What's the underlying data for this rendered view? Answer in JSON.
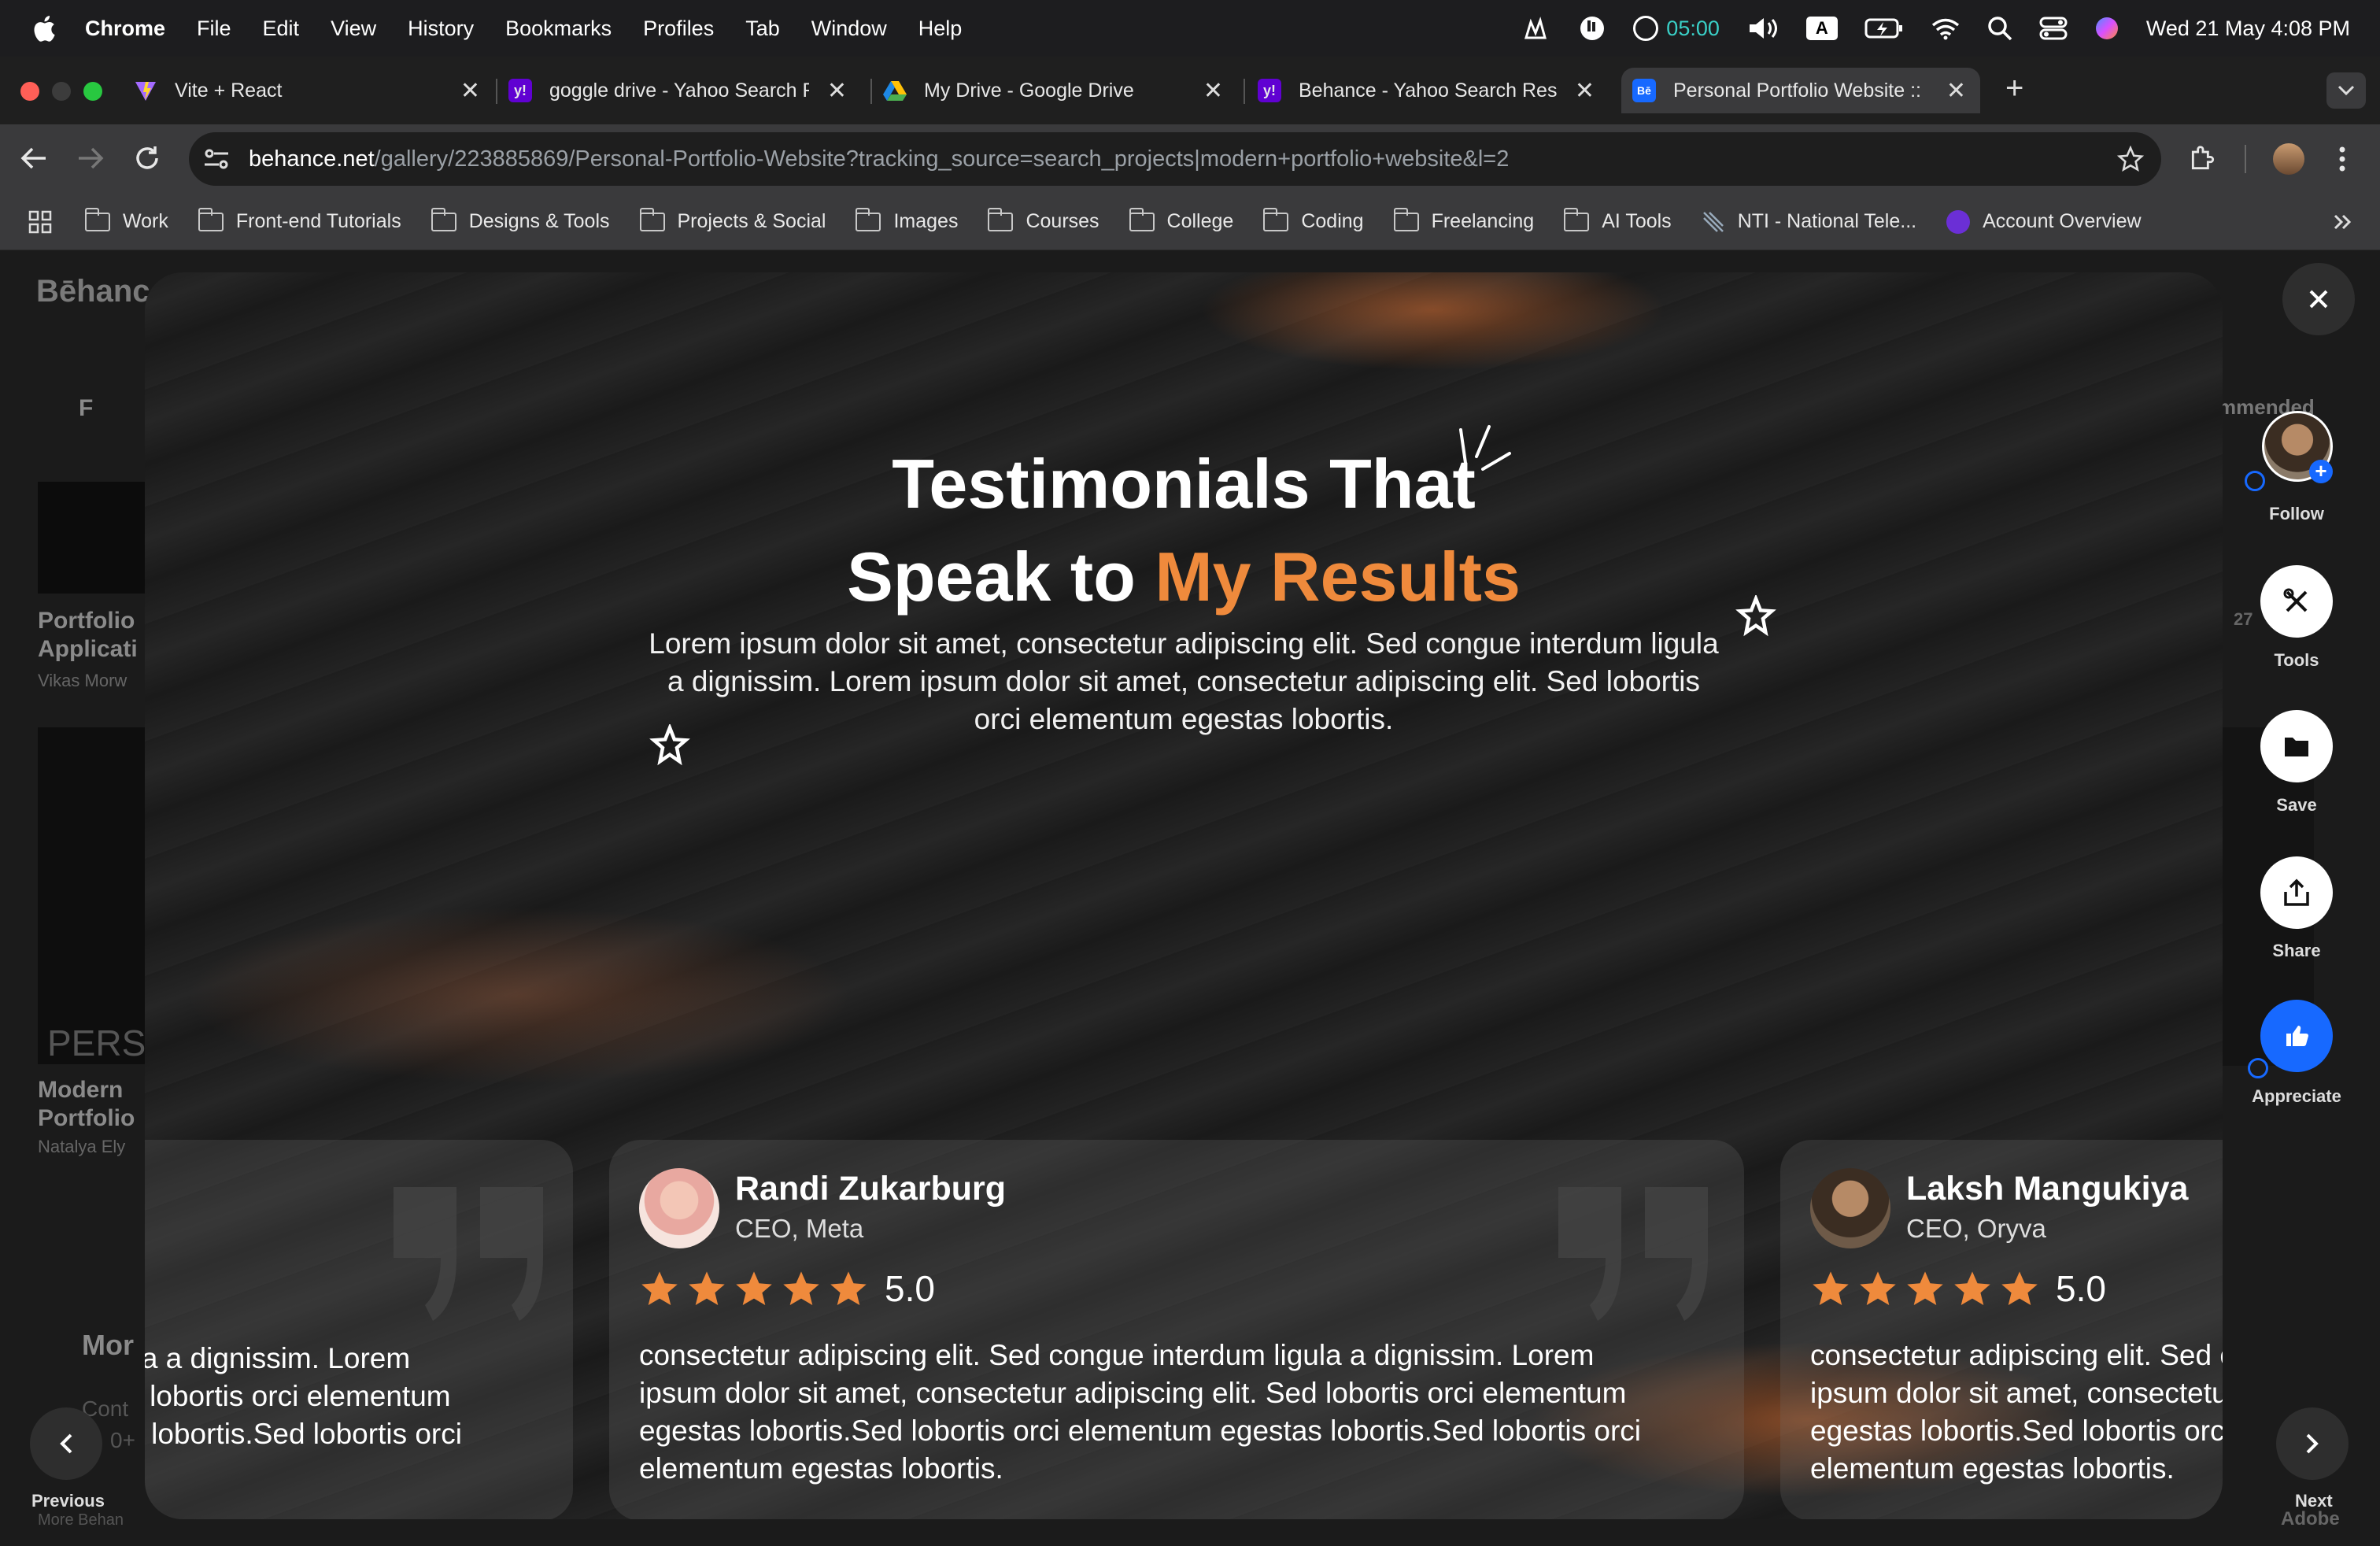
{
  "menubar": {
    "app": "Chrome",
    "items": [
      "File",
      "Edit",
      "View",
      "History",
      "Bookmarks",
      "Profiles",
      "Tab",
      "Window",
      "Help"
    ],
    "timer": "05:00",
    "input_source": "A",
    "datetime": "Wed 21 May  4:08 PM"
  },
  "tabs": [
    {
      "title": "Vite + React",
      "icon": "vite-icon"
    },
    {
      "title": "goggle drive - Yahoo Search R",
      "icon": "yahoo-icon"
    },
    {
      "title": "My Drive - Google Drive",
      "icon": "google-drive-icon"
    },
    {
      "title": "Behance - Yahoo Search Resu",
      "icon": "yahoo-icon"
    },
    {
      "title": "Personal Portfolio Website :: B",
      "icon": "behance-icon",
      "active": true
    }
  ],
  "address": {
    "host": "behance.net",
    "path": "/gallery/223885869/Personal-Portfolio-Website?tracking_source=search_projects|modern+portfolio+website&l=2"
  },
  "bookmarks": [
    "Work",
    "Front-end Tutorials",
    "Designs & Tools",
    "Projects & Social",
    "Images",
    "Courses",
    "College",
    "Coding",
    "Freelancing",
    "AI Tools",
    "NTI - National Tele...",
    "Account Overview"
  ],
  "background_page": {
    "logo": "Bēhance",
    "filter": "F",
    "card1_title_1": "Portfolio",
    "card1_title_2": "Applicati",
    "card1_author": "Vikas Morw",
    "card2_title_1": "Modern",
    "card2_title_2": "Portfolio",
    "card2_author": "Natalya Ely",
    "card2_overlay": "PERS",
    "more": "Mor",
    "more_sub1": "Cont",
    "more_sub2": "0+",
    "more_behance": "More Behan",
    "recommended": "mmended",
    "right_count": "27",
    "adobe": "Adobe"
  },
  "modal": {
    "headline_1": "Testimonials That",
    "headline_2a": "Speak to ",
    "headline_2b": "My Results",
    "subtitle": "Lorem ipsum dolor sit amet, consectetur adipiscing elit. Sed congue interdum ligula a dignissim. Lorem ipsum dolor sit amet, consectetur adipiscing elit. Sed lobortis orci elementum egestas lobortis.",
    "accent_color": "#ef8a3c",
    "testimonials": [
      {
        "body": "ligula a dignissim. Lorem\nSed lobortis orci elementum\nstas lobortis.Sed lobortis orci"
      },
      {
        "name": "Randi Zukarburg",
        "role": "CEO, Meta",
        "rating": "5.0",
        "stars": 5,
        "body": "consectetur adipiscing elit. Sed congue interdum ligula a dignissim. Lorem\nipsum dolor sit amet, consectetur adipiscing elit. Sed lobortis orci elementum\negestas lobortis.Sed lobortis orci elementum egestas lobortis.Sed lobortis orci\nelementum egestas lobortis."
      },
      {
        "name": "Laksh Mangukiya",
        "role": "CEO, Oryva",
        "rating": "5.0",
        "stars": 5,
        "body": "consectetur adipiscing elit. Sed congue interdum ligula a dignissim. Lorem\nipsum dolor sit amet, consectetur adipiscing elit. Sed lobortis orci elementum\negestas lobortis.Sed lobortis orci elementum egestas lobortis.Sed lobortis orci\nelementum egestas lobortis."
      }
    ]
  },
  "actions": {
    "follow": "Follow",
    "tools": "Tools",
    "save": "Save",
    "share": "Share",
    "appreciate": "Appreciate",
    "previous": "Previous",
    "next": "Next"
  }
}
